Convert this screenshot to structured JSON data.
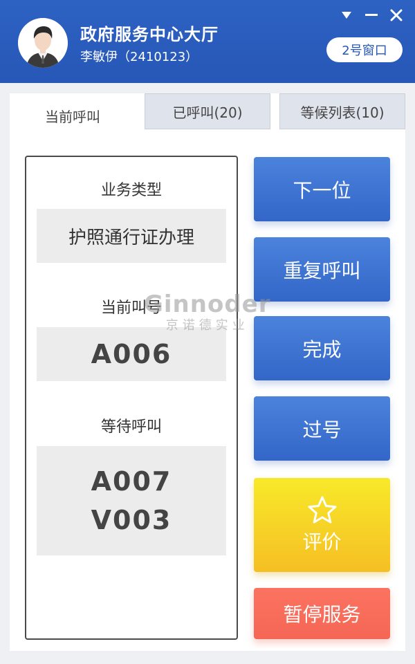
{
  "header": {
    "title": "政府服务中心大厅",
    "user": "李敏伊（2410123）",
    "window_badge": "2号窗口"
  },
  "window_controls": {
    "menu_icon": "dropdown-triangle-icon",
    "minimize_icon": "minimize-icon",
    "close_icon": "close-icon"
  },
  "tabs": [
    {
      "label": "当前呼叫",
      "active": true
    },
    {
      "label": "已呼叫(20)",
      "active": false
    },
    {
      "label": "等候列表(10)",
      "active": false
    }
  ],
  "current": {
    "business_type_label": "业务类型",
    "business_type_value": "护照通行证办理",
    "current_number_label": "当前叫号",
    "current_number_value": "A006",
    "waiting_label": "等待呼叫",
    "waiting_values": [
      "A007",
      "V003"
    ]
  },
  "actions": {
    "next": "下一位",
    "repeat": "重复呼叫",
    "complete": "完成",
    "skip": "过号",
    "rate": "评价",
    "pause": "暂停服务"
  },
  "watermark": {
    "brand": "Ginnoder",
    "company": "京诺德实业"
  },
  "colors": {
    "header_blue": "#2757b7",
    "button_blue": "#3f74d2",
    "button_yellow": "#f6d027",
    "button_red": "#f66c5a"
  }
}
